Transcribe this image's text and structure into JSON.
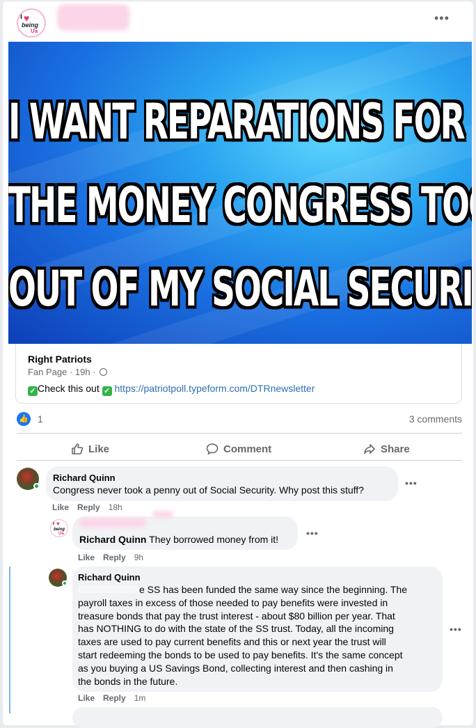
{
  "post": {
    "menu_label": "•••",
    "image_lines": [
      "I WANT REPARATIONS FOR ALL",
      "THE MONEY CONGRESS TOOK",
      "OUT OF MY SOCIAL SECURITY!"
    ],
    "page_name": "Right Patriots",
    "page_meta": "Fan Page · 19h ·",
    "text_before": "Check this out",
    "link": "https://patriotpoll.typeform.com/DTRnewsletter",
    "like_count": "1",
    "comments_count": "3 comments",
    "actions": {
      "like": "Like",
      "comment": "Comment",
      "share": "Share"
    }
  },
  "comments": [
    {
      "author": "Richard Quinn",
      "text": "Congress never took a penny out of Social Security. Why post this stuff?",
      "like": "Like",
      "reply": "Reply",
      "time": "18h"
    },
    {
      "mention": "Richard Quinn",
      "text": " They borrowed money from it!",
      "like": "Like",
      "reply": "Reply",
      "time": "9h"
    },
    {
      "author": "Richard Quinn",
      "lines": [
        "e SS has been funded the same way since the beginning. The",
        "payroll taxes in excess of those needed to pay benefits were invested in",
        "treasure bonds that pay the trust interest - about $80 billion per year. That",
        "has NOTHING to do with the state of the SS trust. Today, all the incoming",
        "taxes are used to pay current benefits and this or next year the trust will",
        "start redeeming the bonds to be used to pay benefits. It's the same concept",
        "as you buying a US Savings Bond, collecting interest and then cashing in",
        "the bonds in the future."
      ],
      "like": "Like",
      "reply": "Reply",
      "time": "1m"
    }
  ],
  "page_avatar": {
    "i": "I",
    "heart": "♥",
    "being": "being",
    "u": "Ua"
  },
  "colors": {
    "accent": "#1877f2",
    "check": "#35b34a",
    "link": "#2d6fb2"
  }
}
